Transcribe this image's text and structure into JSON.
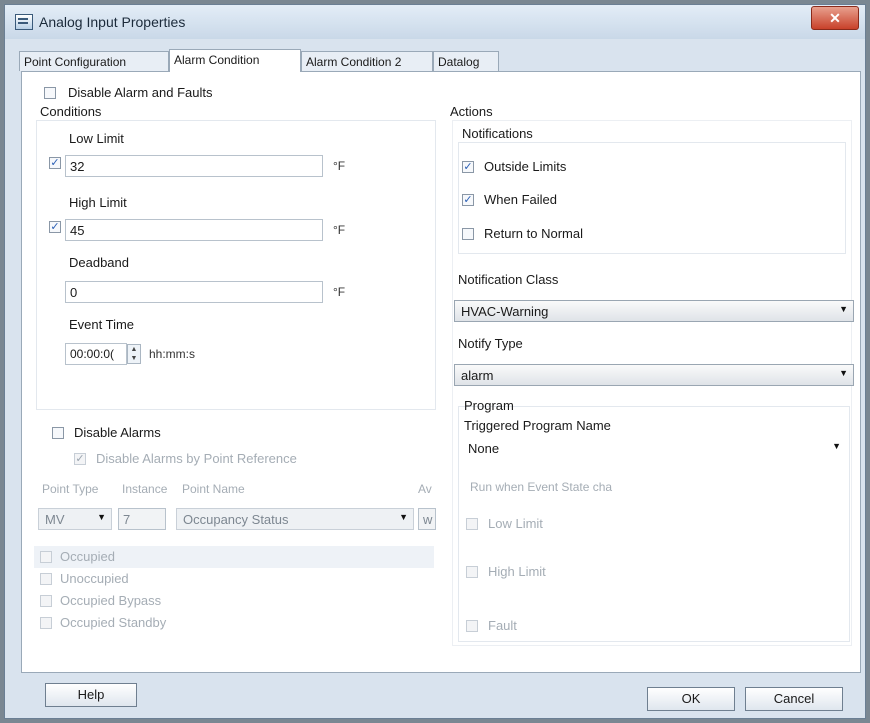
{
  "window": {
    "title": "Analog Input Properties",
    "close_glyph": "✕"
  },
  "tabs": [
    "Point Configuration",
    "Alarm Condition",
    "Alarm Condition 2",
    "Datalog"
  ],
  "left": {
    "disable_alarm_faults": "Disable Alarm and Faults",
    "conditions_title": "Conditions",
    "low_limit_label": "Low Limit",
    "low_limit_value": "32",
    "high_limit_label": "High Limit",
    "high_limit_value": "45",
    "unit": "°F",
    "deadband_label": "Deadband",
    "deadband_value": "0",
    "event_time_label": "Event Time",
    "event_time_value": "00:00:0(",
    "event_time_format": "hh:mm:s",
    "disable_alarms": "Disable Alarms",
    "disable_alarms_by_ref": "Disable Alarms by Point Reference",
    "ref_headers": [
      "Point Type",
      "Instance",
      "Point Name",
      "Av"
    ],
    "point_type": "MV",
    "instance": "7",
    "point_name": "Occupancy Status",
    "av_value": "w",
    "states": [
      "Occupied",
      "Unoccupied",
      "Occupied Bypass",
      "Occupied Standby"
    ]
  },
  "right": {
    "actions_title": "Actions",
    "notifications_title": "Notifications",
    "outside_limits": "Outside Limits",
    "when_failed": "When Failed",
    "return_to_normal": "Return to Normal",
    "notification_class_label": "Notification Class",
    "notification_class_value": "HVAC-Warning",
    "notify_type_label": "Notify Type",
    "notify_type_value": "alarm",
    "program_title": "Program",
    "triggered_program_label": "Triggered Program Name",
    "triggered_program_value": "None",
    "run_when_label": "Run when Event State cha",
    "program_low_limit": "Low Limit",
    "program_high_limit": "High Limit",
    "program_fault": "Fault"
  },
  "buttons": {
    "help": "Help",
    "ok": "OK",
    "cancel": "Cancel"
  },
  "check_glyph": "✓",
  "dropdown_glyph": "▼",
  "colors": {
    "accent_check": "#2b5fb5",
    "close_button": "#c8412a"
  }
}
